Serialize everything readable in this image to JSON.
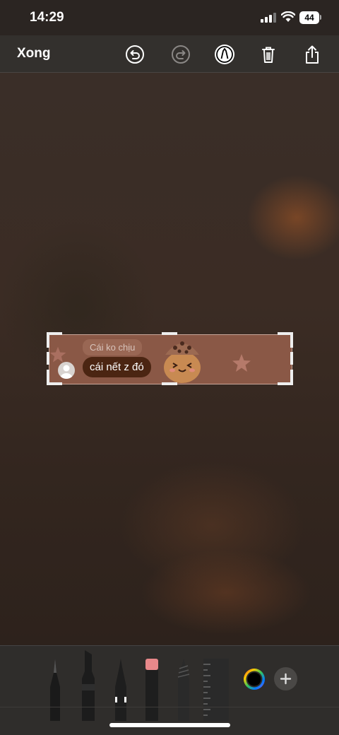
{
  "status_bar": {
    "time": "14:29",
    "battery": "44"
  },
  "toolbar": {
    "done_label": "Xong",
    "icons": [
      "undo-icon",
      "redo-icon",
      "markup-pen-icon",
      "trash-icon",
      "share-icon"
    ]
  },
  "sticker": {
    "reply_text": "Cái ko chịu",
    "message_text": "cái nết z đó"
  },
  "tools": {
    "items": [
      "pen-icon",
      "marker-icon",
      "pencil-icon",
      "eraser-icon",
      "crayon-icon",
      "ruler-icon",
      "color-wheel-icon",
      "add-icon"
    ]
  },
  "colors": {
    "sticker_bg": "#8a5846",
    "bubble": "#4b2512",
    "toolbar_bg": "#33302d"
  }
}
